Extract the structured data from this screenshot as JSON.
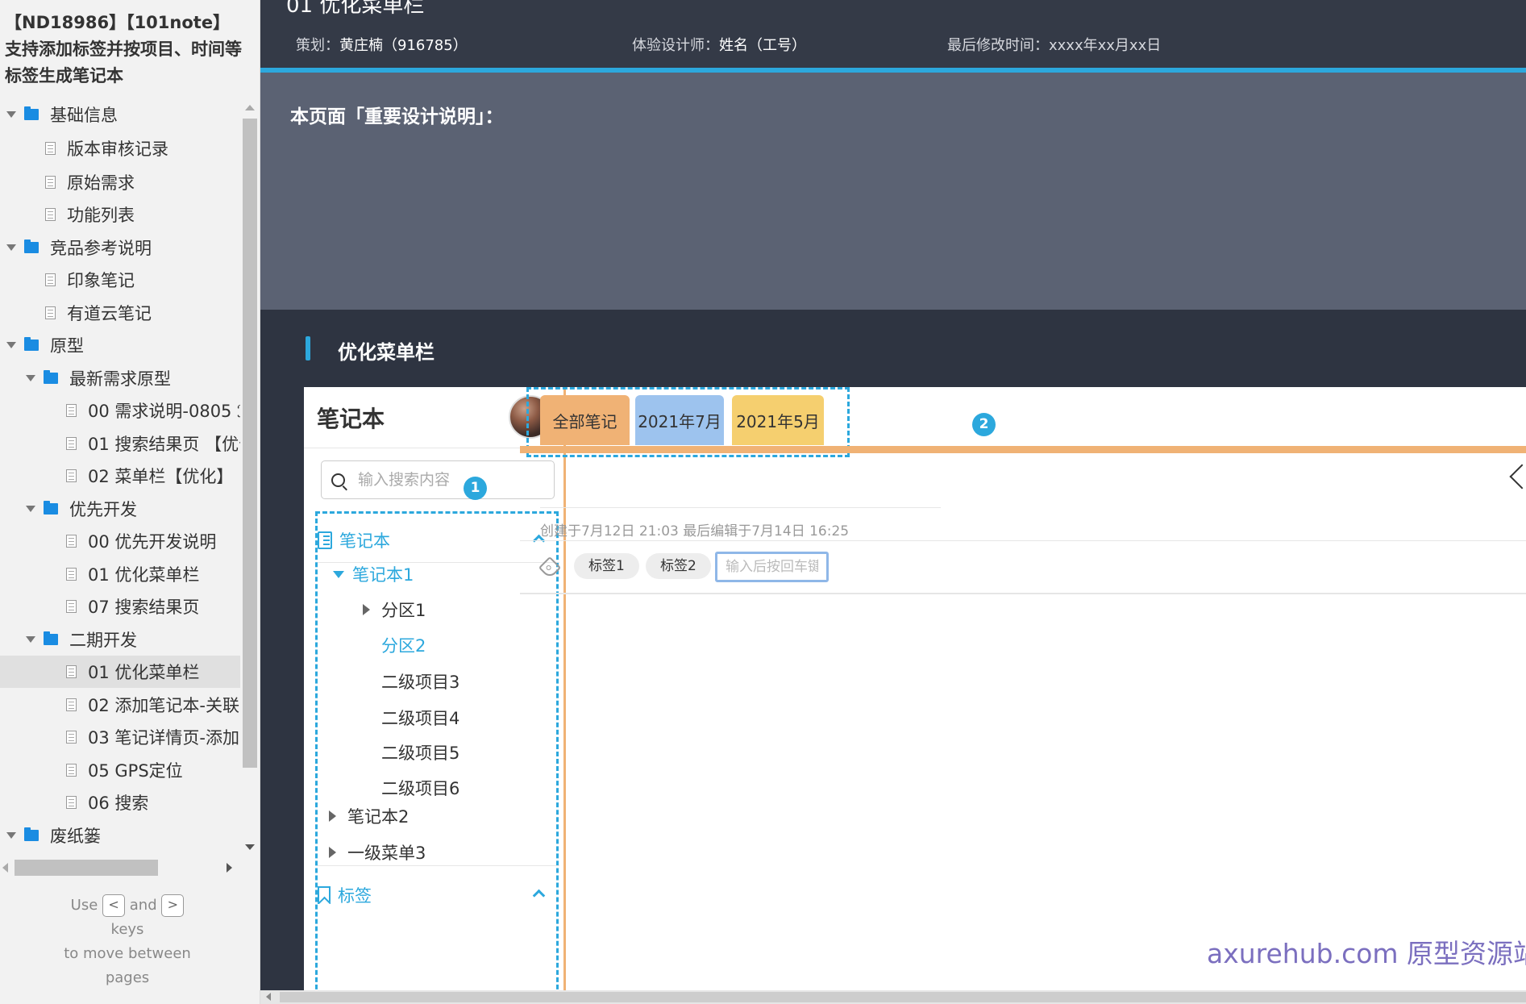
{
  "sitemap": {
    "project_title": "【ND18986】【101note】支持添加标签并按项目、时间等标签生成笔记本",
    "items": [
      {
        "label": "基础信息",
        "type": "folder"
      },
      {
        "label": "版本审核记录",
        "type": "page"
      },
      {
        "label": "原始需求",
        "type": "page"
      },
      {
        "label": "功能列表",
        "type": "page"
      },
      {
        "label": "竞品参考说明",
        "type": "folder"
      },
      {
        "label": "印象笔记",
        "type": "page"
      },
      {
        "label": "有道云笔记",
        "type": "page"
      },
      {
        "label": "原型",
        "type": "folder"
      },
      {
        "label": "最新需求原型",
        "type": "folder"
      },
      {
        "label": "00 需求说明-0805 ℐ",
        "type": "page"
      },
      {
        "label": "01 搜索结果页 【优化",
        "type": "page"
      },
      {
        "label": "02 菜单栏【优化】",
        "type": "page"
      },
      {
        "label": "优先开发",
        "type": "folder"
      },
      {
        "label": "00 优先开发说明",
        "type": "page"
      },
      {
        "label": "01 优化菜单栏",
        "type": "page"
      },
      {
        "label": "07 搜索结果页",
        "type": "page"
      },
      {
        "label": "二期开发",
        "type": "folder"
      },
      {
        "label": "01 优化菜单栏",
        "type": "page",
        "selected": true
      },
      {
        "label": "02 添加笔记本-关联",
        "type": "page"
      },
      {
        "label": "03 笔记详情页-添加",
        "type": "page"
      },
      {
        "label": "05 GPS定位",
        "type": "page"
      },
      {
        "label": "06 搜索",
        "type": "page"
      },
      {
        "label": "废纸篓",
        "type": "folder"
      }
    ],
    "hint": {
      "use": "Use",
      "prev_key": "<",
      "and": "and",
      "next_key": ">",
      "keys": "keys",
      "line3": "to move between",
      "line4": "pages"
    }
  },
  "header": {
    "page_title": "01 优化菜单栏",
    "planner_label": "策划：",
    "planner_value": "黄庄楠（916785）",
    "designer_label": "体验设计师：",
    "designer_value": "姓名（工号）",
    "modified": "最后修改时间：xxxx年xx月xx日"
  },
  "notes": {
    "heading": "本页面「重要设计说明」："
  },
  "section": {
    "title": "优化菜单栏"
  },
  "prototype": {
    "app_title": "笔记本",
    "search_placeholder": "输入搜索内容",
    "badges": [
      "1",
      "2"
    ],
    "notebook_section": "笔记本",
    "notebook1": "笔记本1",
    "part1": "分区1",
    "part2": "分区2",
    "sub_items": [
      "二级项目3",
      "二级项目4",
      "二级项目5",
      "二级项目6"
    ],
    "notebook2": "笔记本2",
    "menu3": "一级菜单3",
    "tags_section": "标签",
    "tabs": [
      "全部笔记",
      "2021年7月",
      "2021年5月"
    ],
    "note_meta": "创建于7月12日 21:03 最后编辑于7月14日 16:25",
    "tags": [
      "标签1",
      "标签2"
    ],
    "tag_input_placeholder": "输入后按回车键",
    "watermark": "axurehub.com 原型资源站"
  },
  "colors": {
    "accent": "#2ca8dd",
    "tab_all": "#f0b275",
    "tab_jul": "#9dc3ee",
    "tab_may": "#f5cf6f",
    "dark_bg": "#2e3441",
    "notes_bg": "#5b6273"
  }
}
